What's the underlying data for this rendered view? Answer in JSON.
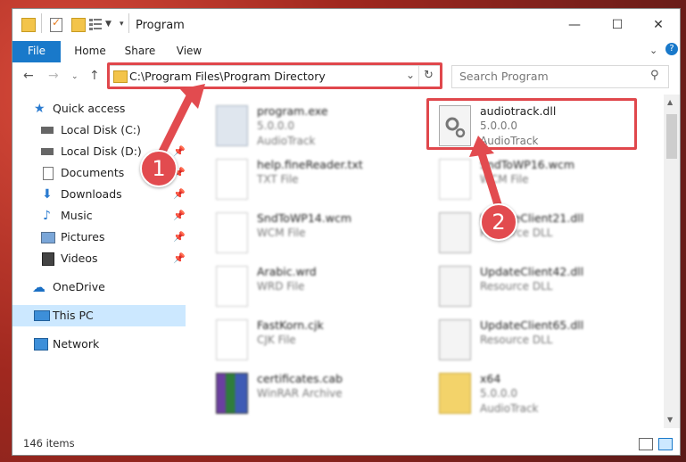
{
  "window": {
    "title": "Program"
  },
  "ribbon": {
    "tabs": [
      "File",
      "Home",
      "Share",
      "View"
    ]
  },
  "address": {
    "path": "C:\\Program Files\\Program Directory"
  },
  "search": {
    "placeholder": "Search Program"
  },
  "nav": {
    "items": [
      {
        "label": "Quick access",
        "icon": "star-icon"
      },
      {
        "label": "Local Disk (C:)",
        "icon": "drive-icon"
      },
      {
        "label": "Local Disk (D:)",
        "icon": "drive-icon"
      },
      {
        "label": "Documents",
        "icon": "document-icon"
      },
      {
        "label": "Downloads",
        "icon": "download-icon"
      },
      {
        "label": "Music",
        "icon": "music-icon"
      },
      {
        "label": "Pictures",
        "icon": "picture-icon"
      },
      {
        "label": "Videos",
        "icon": "video-icon"
      },
      {
        "label": "OneDrive",
        "icon": "cloud-icon"
      },
      {
        "label": "This PC",
        "icon": "computer-icon"
      },
      {
        "label": "Network",
        "icon": "network-icon"
      }
    ]
  },
  "files": {
    "left": [
      {
        "name": "program.exe",
        "sub1": "5.0.0.0",
        "sub2": "AudioTrack"
      },
      {
        "name": "help.fineReader.txt",
        "sub1": "TXT File",
        "sub2": ""
      },
      {
        "name": "SndToWP14.wcm",
        "sub1": "WCM File",
        "sub2": ""
      },
      {
        "name": "Arabic.wrd",
        "sub1": "WRD File",
        "sub2": ""
      },
      {
        "name": "FastKorn.cjk",
        "sub1": "CJK File",
        "sub2": ""
      },
      {
        "name": "certificates.cab",
        "sub1": "WinRAR Archive",
        "sub2": ""
      }
    ],
    "right": [
      {
        "name": "audiotrack.dll",
        "sub1": "5.0.0.0",
        "sub2": "AudioTrack"
      },
      {
        "name": "SndToWP16.wcm",
        "sub1": "WCM File",
        "sub2": ""
      },
      {
        "name": "UpdateClient21.dll",
        "sub1": "Resource DLL",
        "sub2": ""
      },
      {
        "name": "UpdateClient42.dll",
        "sub1": "Resource DLL",
        "sub2": ""
      },
      {
        "name": "UpdateClient65.dll",
        "sub1": "Resource DLL",
        "sub2": ""
      },
      {
        "name": "x64",
        "sub1": "5.0.0.0",
        "sub2": "AudioTrack"
      }
    ]
  },
  "status": {
    "count": "146 items"
  },
  "callouts": [
    "1",
    "2"
  ],
  "colors": {
    "accent": "#1979ca",
    "highlight": "#e0474c",
    "selection": "#cce8ff"
  }
}
